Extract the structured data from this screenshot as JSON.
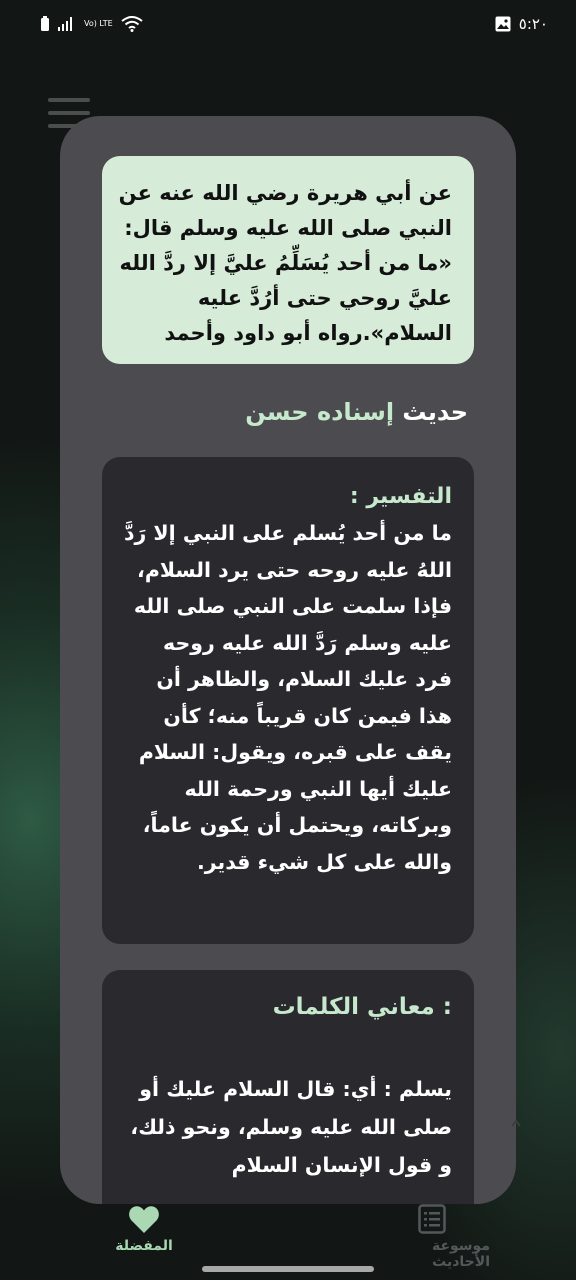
{
  "status_bar": {
    "time": "٥:٢٠",
    "network_label": "Vo) LTE",
    "icons": [
      "battery-icon",
      "signal-icon",
      "wifi-icon",
      "gallery-icon"
    ]
  },
  "hadith": {
    "text": "عن أبي هريرة رضي الله عنه عن النبي صلى الله عليه وسلم قال: «ما من أحد يُسَلِّمُ عليَّ إلا ردَّ الله عليَّ روحي حتى أرُدَّ عليه السلام».رواه أبو داود وأحمد"
  },
  "grade": {
    "prefix": "حديث",
    "value": "إسناده حسن"
  },
  "tafsir": {
    "title": "التفسير :",
    "text": "ما من أحد يُسلم على النبي إلا رَدَّ اللهُ عليه روحه حتى يرد السلام، فإذا سلمت على النبي صلى الله عليه وسلم رَدَّ الله عليه روحه فرد عليك السلام، والظاهر أن هذا فيمن كان قريباً منه؛ كأن يقف على قبره، ويقول: السلام عليك أيها النبي ورحمة الله وبركاته، ويحتمل أن يكون عاماً، والله على كل شيء قدير."
  },
  "meanings": {
    "title": ": معاني الكلمات",
    "text": "يسلم :  أي: قال السلام عليك أو صلى الله عليه وسلم، ونحو ذلك، و قول الإنسان السلام"
  },
  "bottom_nav": {
    "favorites_label": "المفضلة",
    "encyclopedia_label": "موسوعة الأحاديث"
  },
  "colors": {
    "accent_green": "#c6e8cc",
    "hadith_bg": "#d6ecd8",
    "card_bg": "#4c4c50",
    "box_bg": "#2a292e"
  }
}
